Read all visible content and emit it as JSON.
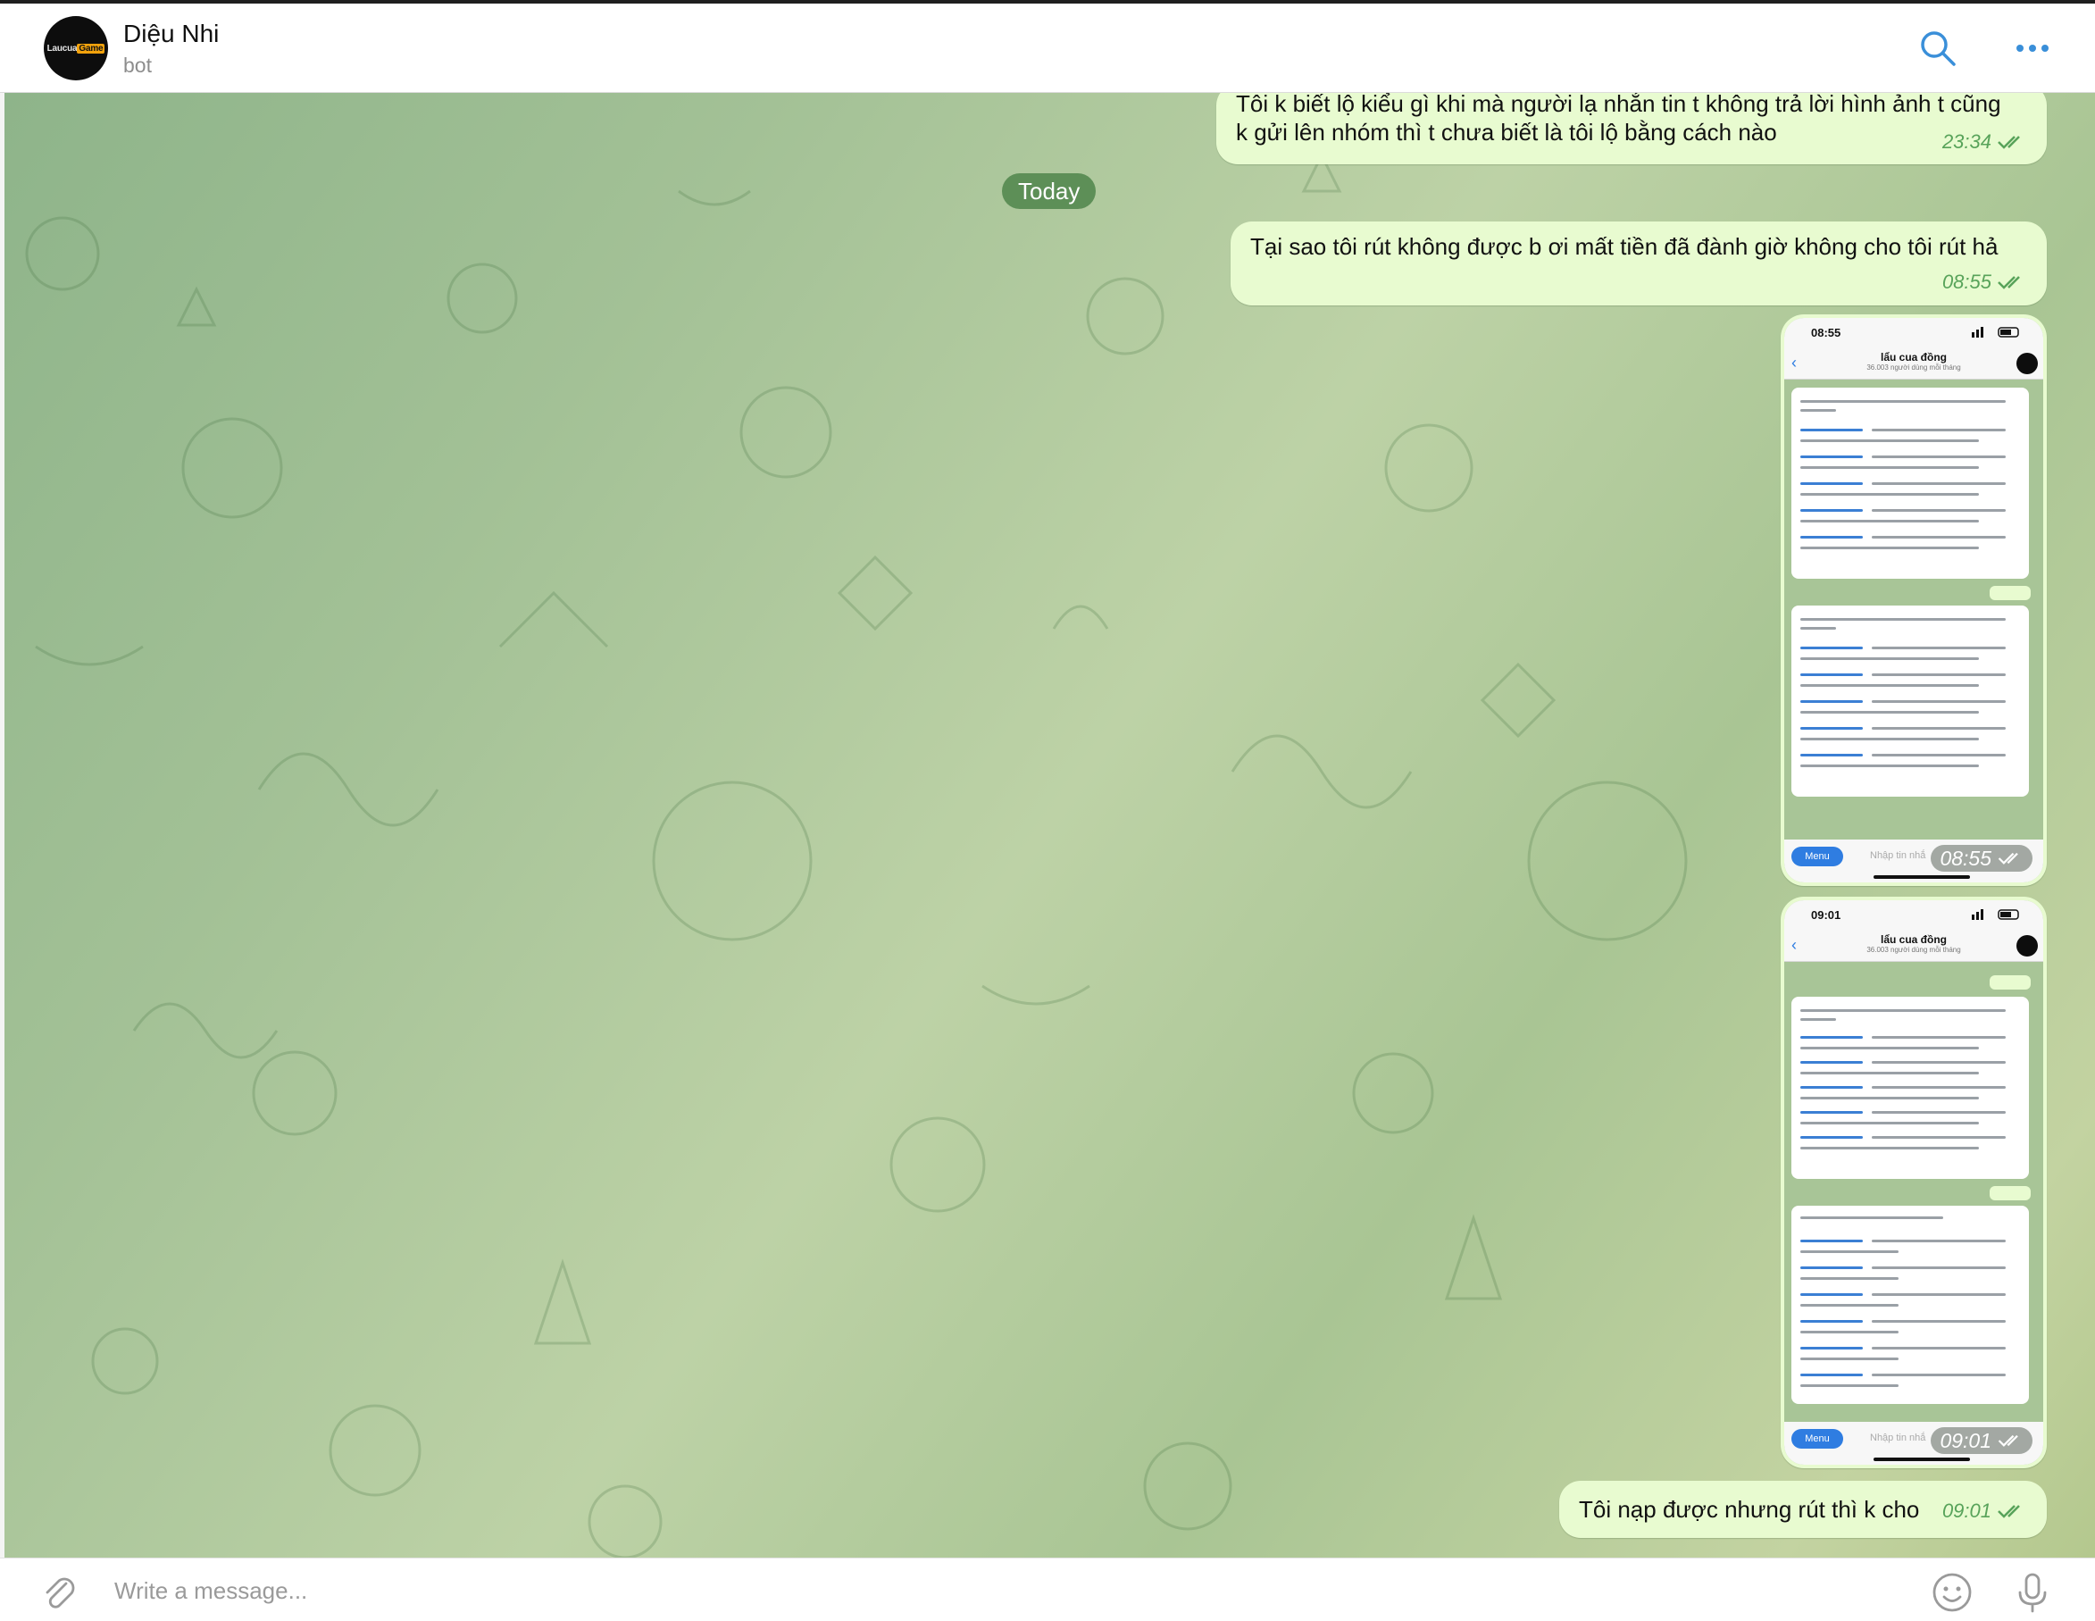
{
  "header": {
    "avatar_logo": {
      "left": "Laucua",
      "right": "Game"
    },
    "name": "Diệu Nhi",
    "status": "bot",
    "icons": [
      "search-icon",
      "more-icon"
    ]
  },
  "chat": {
    "date_separator": "Today",
    "messages": [
      {
        "type": "text",
        "text_line1": "Tôi k biết lộ kiểu gì khi mà người lạ nhắn tin t không trả lời hình ảnh t cũng",
        "text_line2": "k gửi lên nhóm thì t chưa biết là tôi lộ bằng cách nào",
        "time": "23:34",
        "status": "read"
      },
      {
        "type": "text",
        "text": "Tại sao tôi rút không được b ơi mất tiền đã đành giờ không cho tôi rút hả",
        "time": "08:55",
        "status": "read"
      },
      {
        "type": "photo",
        "time": "08:55",
        "status": "read",
        "screenshot": {
          "status_time": "08:55",
          "title": "lẩu cua đồng",
          "subtitle": "36.003 người dùng mỗi tháng",
          "menu_label": "Menu",
          "input_placeholder": "Nhập tin nhắ"
        }
      },
      {
        "type": "photo",
        "time": "09:01",
        "status": "read",
        "screenshot": {
          "status_time": "09:01",
          "title": "lẩu cua đồng",
          "subtitle": "36.003 người dùng mỗi tháng",
          "menu_label": "Menu",
          "input_placeholder": "Nhập tin nhắ"
        }
      },
      {
        "type": "text",
        "text": "Tôi nạp được nhưng rút thì k cho",
        "time": "09:01",
        "status": "read"
      }
    ]
  },
  "composer": {
    "placeholder": "Write a message...",
    "icons": [
      "paperclip-icon",
      "emoji-icon",
      "microphone-icon"
    ]
  },
  "colors": {
    "outgoing_bubble": "#e8fbd0",
    "timestamp": "#58a35a",
    "date_pill": "#5d8f57",
    "accent": "#3a8fd9"
  }
}
